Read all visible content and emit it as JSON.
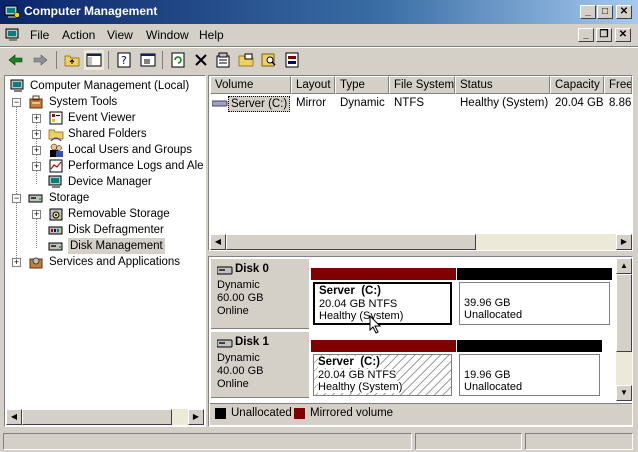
{
  "window": {
    "title": "Computer Management",
    "min_glyph": "_",
    "max_glyph": "□",
    "close_glyph": "✕"
  },
  "menu": {
    "file": "File",
    "action": "Action",
    "view": "View",
    "window": "Window",
    "help": "Help"
  },
  "tree": {
    "root": "Computer Management (Local)",
    "system_tools": "System Tools",
    "event_viewer": "Event Viewer",
    "shared_folders": "Shared Folders",
    "local_users": "Local Users and Groups",
    "perf_logs": "Performance Logs and Alerts",
    "device_manager": "Device Manager",
    "storage": "Storage",
    "removable_storage": "Removable Storage",
    "disk_defrag": "Disk Defragmenter",
    "disk_management": "Disk Management",
    "services_apps": "Services and Applications"
  },
  "volume_table": {
    "headers": [
      "Volume",
      "Layout",
      "Type",
      "File System",
      "Status",
      "Capacity",
      "Free"
    ],
    "rows": [
      {
        "volume": "Server (C:)",
        "layout": "Mirror",
        "type": "Dynamic",
        "fs": "NTFS",
        "status": "Healthy (System)",
        "capacity": "20.04 GB",
        "free": "8.86"
      }
    ]
  },
  "disks": [
    {
      "name": "Disk 0",
      "type": "Dynamic",
      "size": "60.00 GB",
      "state": "Online",
      "partitions": [
        {
          "name": "Server  (C:)",
          "detail": "20.04 GB NTFS",
          "status": "Healthy (System)"
        },
        {
          "name": "",
          "detail": "39.96 GB",
          "status": "Unallocated"
        }
      ]
    },
    {
      "name": "Disk 1",
      "type": "Dynamic",
      "size": "40.00 GB",
      "state": "Online",
      "partitions": [
        {
          "name": "Server  (C:)",
          "detail": "20.04 GB NTFS",
          "status": "Healthy (System)"
        },
        {
          "name": "",
          "detail": "19.96 GB",
          "status": "Unallocated"
        }
      ]
    }
  ],
  "legend": {
    "unallocated": "Unallocated",
    "mirrored": "Mirrored volume"
  },
  "colors": {
    "mirrored": "#800000",
    "unallocated": "#000000",
    "title_start": "#0a246a",
    "title_end": "#a6caf0",
    "selection": "#d4d0c8"
  }
}
